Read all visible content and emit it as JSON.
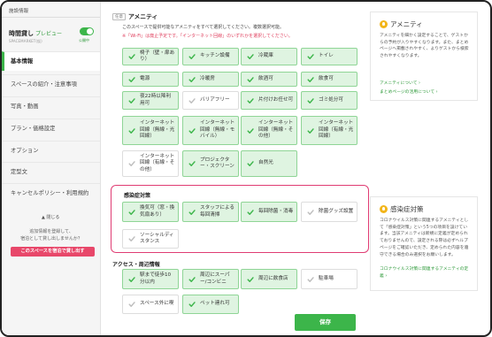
{
  "sidebar": {
    "title": "施設情報",
    "space_name": "時間貸し",
    "preview_label": "プレビュー",
    "company": "SPACEMARKET(仮)",
    "toggle_label": "公開中",
    "items": [
      {
        "label": "基本情報",
        "active": true
      },
      {
        "label": "スペースの紹介・注意事項",
        "active": false
      },
      {
        "label": "写真・動画",
        "active": false
      },
      {
        "label": "プラン・価格設定",
        "active": false
      },
      {
        "label": "オプション",
        "active": false
      },
      {
        "label": "定型文",
        "active": false
      },
      {
        "label": "キャンセルポリシー・利用規約",
        "active": false
      }
    ],
    "close_label": "▲ 閉じる",
    "note": "追加情報を登録して、\n宿泊として貸し出しませんか？",
    "rent_button": "このスペースを宿泊で貸し出す"
  },
  "amenity": {
    "tag": "任意",
    "heading": "アメニティ",
    "desc": "このスペースで提供可能なアメニティをすべて選択してください。複数選択可能。",
    "warning": "※「Wi-Fi」は廃止予定です。「インターネット回線」のいずれかを選択してください。",
    "chips": [
      {
        "label": "椅子（壁・扉あり）",
        "checked": true
      },
      {
        "label": "キッチン設備",
        "checked": true
      },
      {
        "label": "冷蔵庫",
        "checked": true
      },
      {
        "label": "トイレ",
        "checked": true
      },
      {
        "label": "電源",
        "checked": true
      },
      {
        "label": "冷暖房",
        "checked": true
      },
      {
        "label": "飲酒可",
        "checked": true
      },
      {
        "label": "飲食可",
        "checked": true
      },
      {
        "label": "夜22時以降利\n用可",
        "checked": true
      },
      {
        "label": "バリアフリー",
        "checked": false
      },
      {
        "label": "片付けお任せ可",
        "checked": true
      },
      {
        "label": "ゴミ処分可",
        "checked": true
      },
      {
        "label": "インターネット\n回線（無線・光\n回線）",
        "checked": true
      },
      {
        "label": "インターネット\n回線（無線・モ\nバイル）",
        "checked": true
      },
      {
        "label": "インターネット\n回線（無線・そ\nの他）",
        "checked": true
      },
      {
        "label": "インターネット\n回線（有線・光\n回線）",
        "checked": true
      },
      {
        "label": "インターネット\n回線（有線・そ\nの他）",
        "checked": false
      },
      {
        "label": "プロジェクタ\nー・スクリーン",
        "checked": true
      },
      {
        "label": "自然光",
        "checked": true
      }
    ]
  },
  "infection": {
    "heading": "感染症対策",
    "chips": [
      {
        "label": "換気可（窓・換\n気扇あり）",
        "checked": true
      },
      {
        "label": "スタッフによる\n毎回清掃",
        "checked": true
      },
      {
        "label": "毎回除菌・消毒",
        "checked": true
      },
      {
        "label": "除菌グッズ設置",
        "checked": false
      },
      {
        "label": "ソーシャルディ\nスタンス",
        "checked": false
      }
    ]
  },
  "access": {
    "heading": "アクセス・周辺情報",
    "chips": [
      {
        "label": "駅まで徒歩10\n分以内",
        "checked": true
      },
      {
        "label": "周辺にスーパ\nー/コンビニ",
        "checked": true
      },
      {
        "label": "周辺に飲食店",
        "checked": true
      },
      {
        "label": "駐車場",
        "checked": false
      },
      {
        "label": "スペース外に喫",
        "checked": false
      },
      {
        "label": "ペット連れ可",
        "checked": true
      }
    ]
  },
  "save_button": "保存",
  "info_amenity": {
    "title": "アメニティ",
    "body": "アメニティを細かく設定することで、ゲストからの予約が入りやすくなります。また、まとめページへ掲載されやすく、よりゲストから検索されやすくなります。",
    "link1": "アメニティについて ›",
    "link2": "まとめページの活用について ›"
  },
  "info_infection": {
    "title": "感染症対策",
    "body": "コロナウイルス対策に関連するアメニティとして「感染症対策」という5つの項目を設けています。当該アメニティは新規に定義が定められておりませんので、設定される際は必ずヘルプページをご確認いただき、定められた内容を遵守できる場合のみ選択をお願いします。",
    "link": "コロナウイルス対策に関連するアメニティの定義 ›"
  },
  "colors": {
    "accent_green": "#3cb54a",
    "chip_green_bg": "#dff4e1",
    "pink": "#e03c73",
    "rent_button": "#e8476a"
  }
}
